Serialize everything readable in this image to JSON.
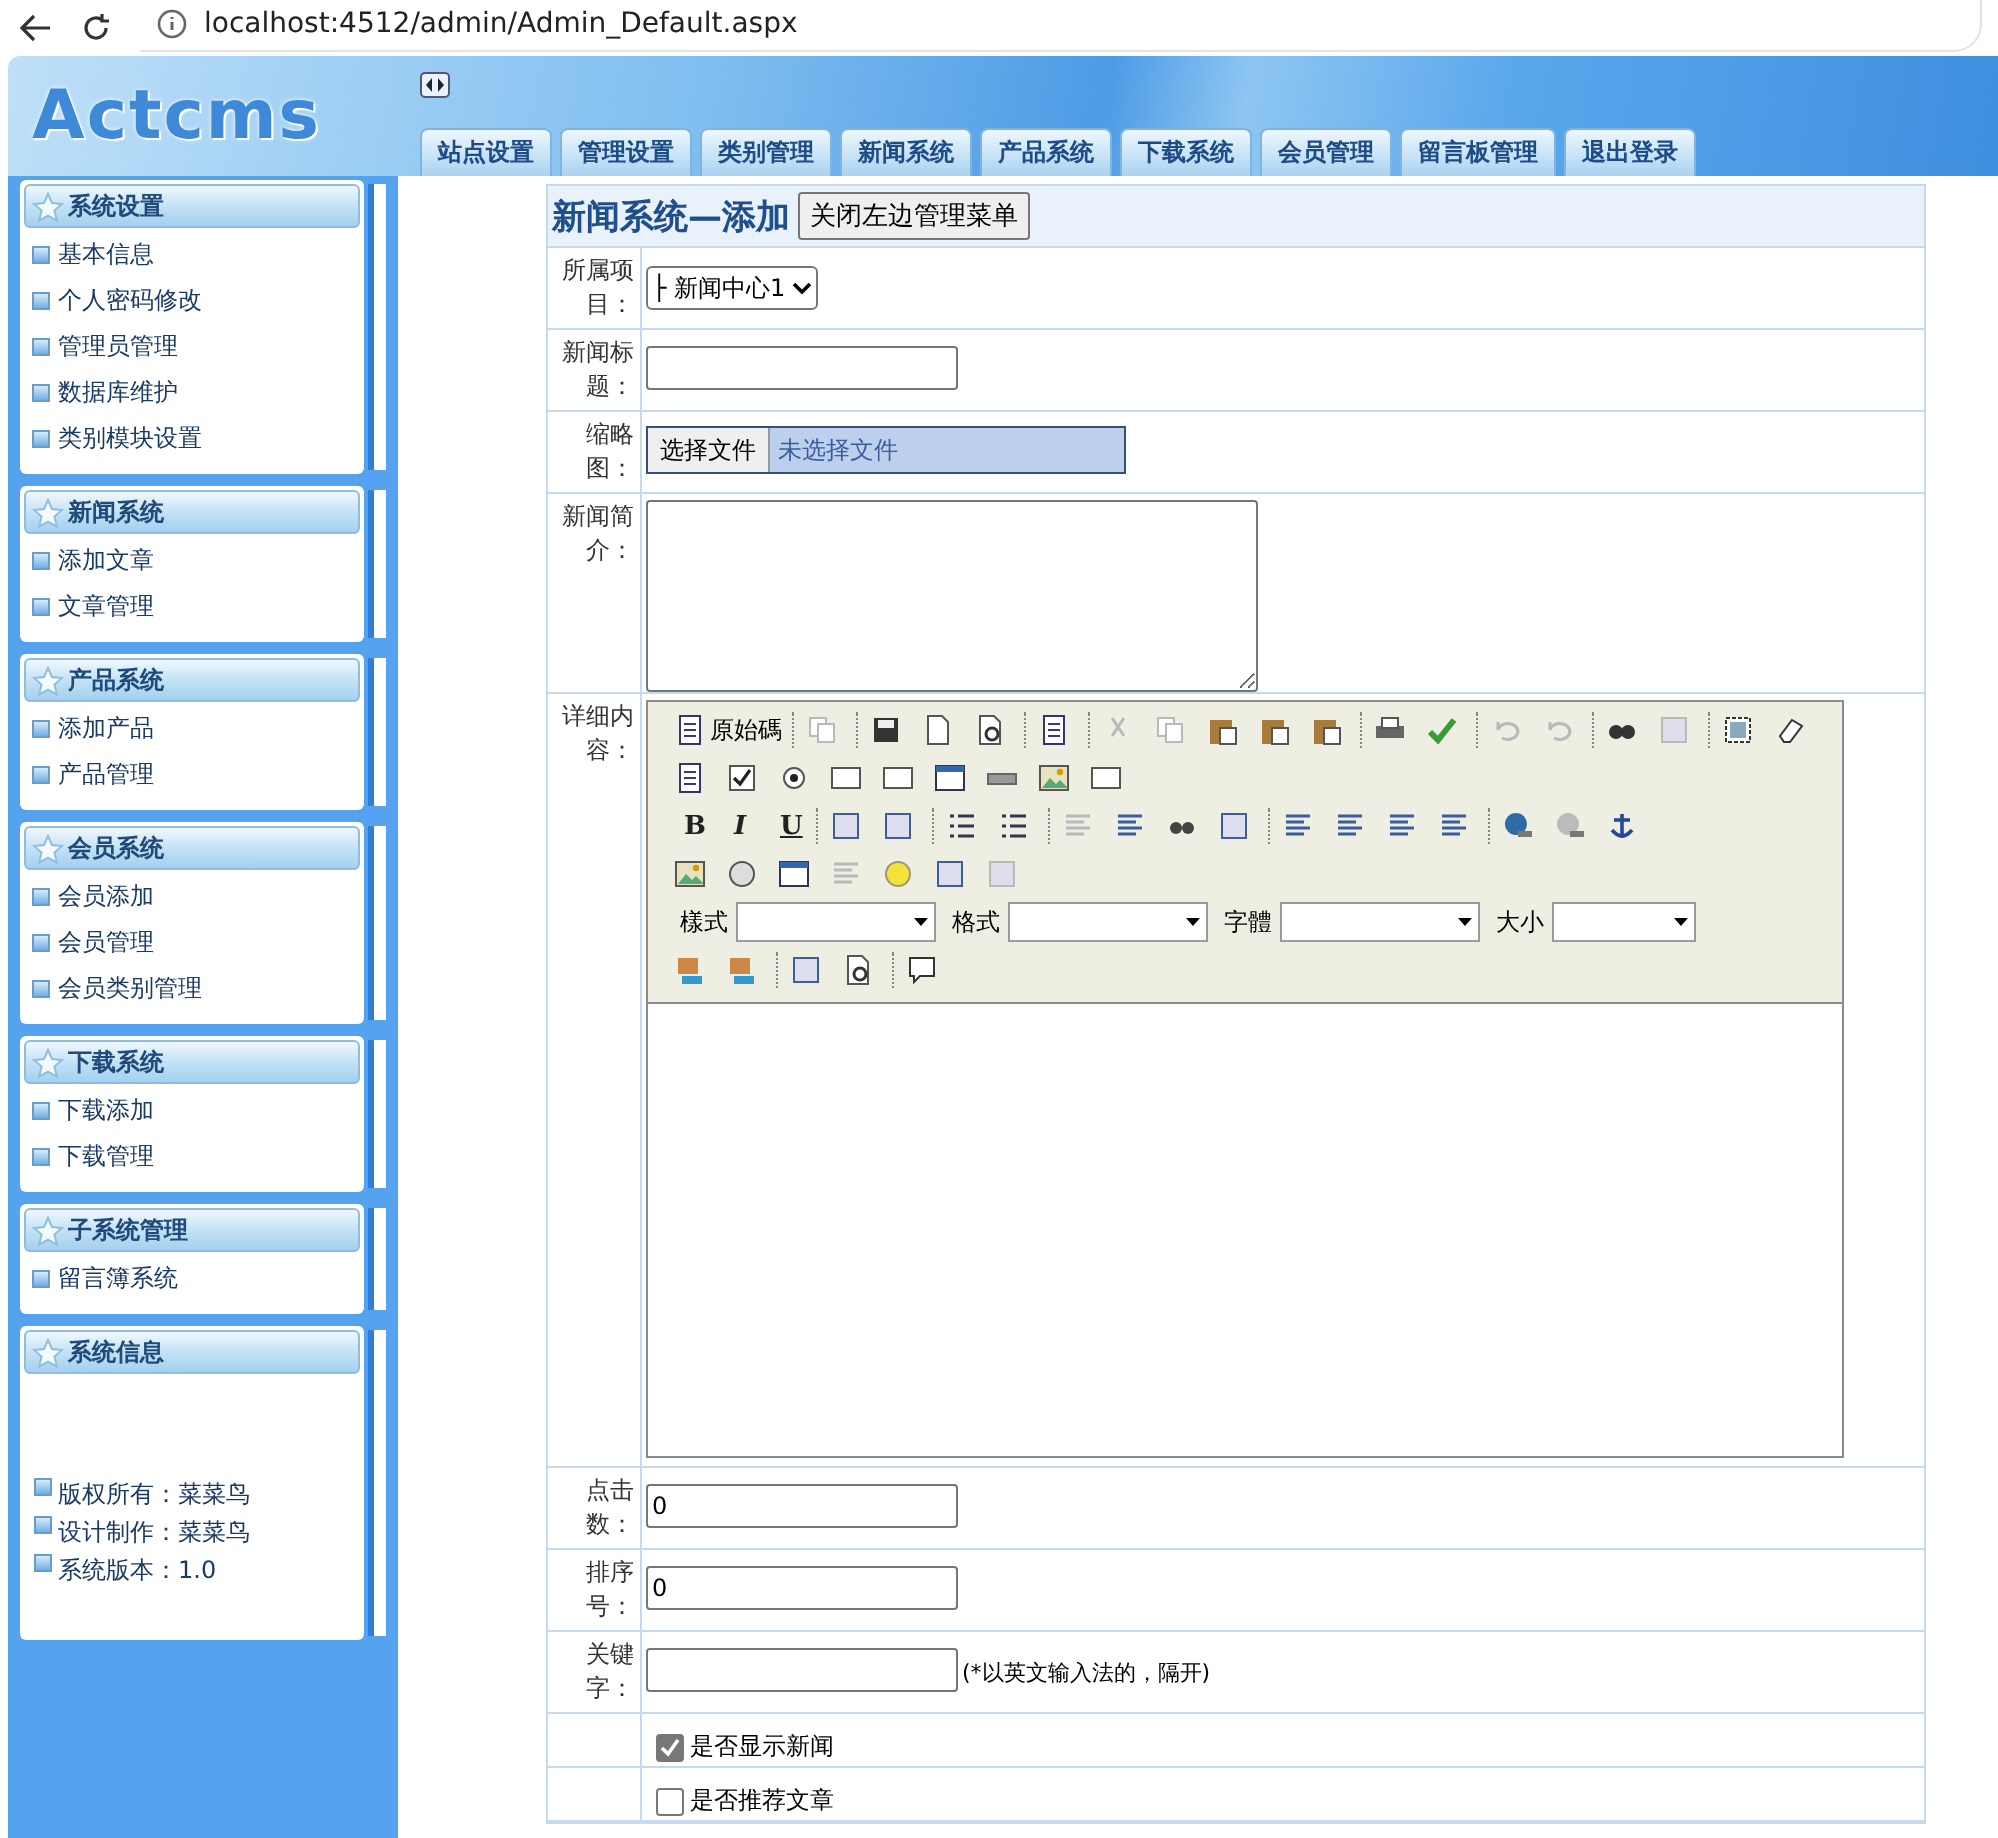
{
  "browser": {
    "url": "localhost:4512/admin/Admin_Default.aspx"
  },
  "header": {
    "logo": "Actcms",
    "tabs": [
      "站点设置",
      "管理设置",
      "类别管理",
      "新闻系统",
      "产品系统",
      "下载系统",
      "会员管理",
      "留言板管理",
      "退出登录"
    ]
  },
  "sidebar": {
    "panels": [
      {
        "title": "系统设置",
        "items": [
          "基本信息",
          "个人密码修改",
          "管理员管理",
          "数据库维护",
          "类别模块设置"
        ]
      },
      {
        "title": "新闻系统",
        "items": [
          "添加文章",
          "文章管理"
        ]
      },
      {
        "title": "产品系统",
        "items": [
          "添加产品",
          "产品管理"
        ]
      },
      {
        "title": "会员系统",
        "items": [
          "会员添加",
          "会员管理",
          "会员类别管理"
        ]
      },
      {
        "title": "下载系统",
        "items": [
          "下载添加",
          "下载管理"
        ]
      },
      {
        "title": "子系统管理",
        "items": [
          "留言簿系统"
        ]
      },
      {
        "title": "系统信息",
        "info": [
          "版权所有：菜菜鸟",
          "设计制作：菜菜鸟",
          "系统版本：1.0"
        ]
      }
    ]
  },
  "form": {
    "title": "新闻系统—添加",
    "close_button": "关闭左边管理菜单",
    "fields": [
      {
        "kind": "select",
        "label": "所属项目：",
        "value": "├ 新闻中心1"
      },
      {
        "kind": "text",
        "label": "新闻标题："
      },
      {
        "kind": "file",
        "label": "缩略图：",
        "button": "选择文件",
        "status": "未选择文件"
      },
      {
        "kind": "textarea",
        "label": "新闻简介："
      },
      {
        "kind": "editor",
        "label": "详细内容："
      },
      {
        "kind": "text",
        "label": "点击数：",
        "value": "0"
      },
      {
        "kind": "text",
        "label": "排序号：",
        "value": "0"
      },
      {
        "kind": "text",
        "label": "关键字：",
        "note": "(*以英文输入法的，隔开)"
      },
      {
        "kind": "checkbox",
        "text": "是否显示新闻",
        "checked": true
      },
      {
        "kind": "checkbox",
        "text": "是否推荐文章",
        "checked": false
      }
    ]
  },
  "editor": {
    "source_label": "原始碼",
    "format_keys": [
      "B",
      "I",
      "U"
    ],
    "selects": [
      "樣式",
      "格式",
      "字體",
      "大小"
    ]
  }
}
